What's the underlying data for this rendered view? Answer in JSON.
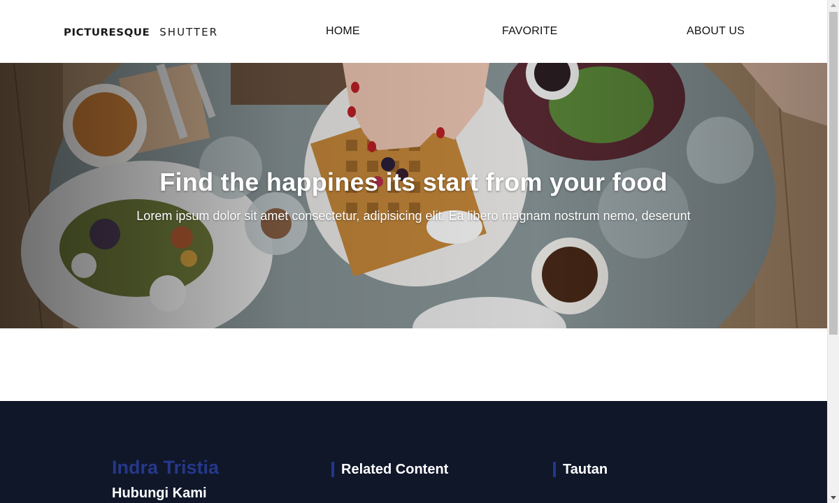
{
  "header": {
    "logo_bold": "PICTURESQUE",
    "logo_light": "SHUTTER",
    "nav": {
      "home": "HOME",
      "favorite": "FAVORITE",
      "about": "ABOUT US"
    }
  },
  "hero": {
    "title": "Find the happines its start from your food",
    "subtitle": "Lorem ipsum dolor sit amet consectetur, adipisicing elit. Ea libero magnam nostrum nemo, deserunt",
    "image": "food-table-photo"
  },
  "footer": {
    "brand_name": "Indra Tristia",
    "contact_title": "Hubungi Kami",
    "related_heading": "Related Content",
    "links_heading": "Tautan"
  },
  "colors": {
    "footer_bg": "#0f1729",
    "accent_blue": "#26388a",
    "hero_text": "#ffffff"
  }
}
